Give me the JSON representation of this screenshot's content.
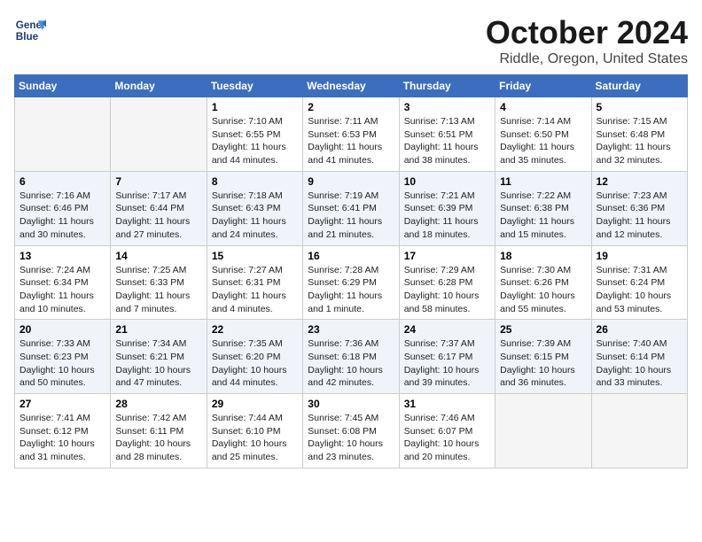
{
  "header": {
    "logo_line1": "General",
    "logo_line2": "Blue",
    "month": "October 2024",
    "location": "Riddle, Oregon, United States"
  },
  "days_of_week": [
    "Sunday",
    "Monday",
    "Tuesday",
    "Wednesday",
    "Thursday",
    "Friday",
    "Saturday"
  ],
  "weeks": [
    [
      {
        "day": "",
        "info": ""
      },
      {
        "day": "",
        "info": ""
      },
      {
        "day": "1",
        "info": "Sunrise: 7:10 AM\nSunset: 6:55 PM\nDaylight: 11 hours and 44 minutes."
      },
      {
        "day": "2",
        "info": "Sunrise: 7:11 AM\nSunset: 6:53 PM\nDaylight: 11 hours and 41 minutes."
      },
      {
        "day": "3",
        "info": "Sunrise: 7:13 AM\nSunset: 6:51 PM\nDaylight: 11 hours and 38 minutes."
      },
      {
        "day": "4",
        "info": "Sunrise: 7:14 AM\nSunset: 6:50 PM\nDaylight: 11 hours and 35 minutes."
      },
      {
        "day": "5",
        "info": "Sunrise: 7:15 AM\nSunset: 6:48 PM\nDaylight: 11 hours and 32 minutes."
      }
    ],
    [
      {
        "day": "6",
        "info": "Sunrise: 7:16 AM\nSunset: 6:46 PM\nDaylight: 11 hours and 30 minutes."
      },
      {
        "day": "7",
        "info": "Sunrise: 7:17 AM\nSunset: 6:44 PM\nDaylight: 11 hours and 27 minutes."
      },
      {
        "day": "8",
        "info": "Sunrise: 7:18 AM\nSunset: 6:43 PM\nDaylight: 11 hours and 24 minutes."
      },
      {
        "day": "9",
        "info": "Sunrise: 7:19 AM\nSunset: 6:41 PM\nDaylight: 11 hours and 21 minutes."
      },
      {
        "day": "10",
        "info": "Sunrise: 7:21 AM\nSunset: 6:39 PM\nDaylight: 11 hours and 18 minutes."
      },
      {
        "day": "11",
        "info": "Sunrise: 7:22 AM\nSunset: 6:38 PM\nDaylight: 11 hours and 15 minutes."
      },
      {
        "day": "12",
        "info": "Sunrise: 7:23 AM\nSunset: 6:36 PM\nDaylight: 11 hours and 12 minutes."
      }
    ],
    [
      {
        "day": "13",
        "info": "Sunrise: 7:24 AM\nSunset: 6:34 PM\nDaylight: 11 hours and 10 minutes."
      },
      {
        "day": "14",
        "info": "Sunrise: 7:25 AM\nSunset: 6:33 PM\nDaylight: 11 hours and 7 minutes."
      },
      {
        "day": "15",
        "info": "Sunrise: 7:27 AM\nSunset: 6:31 PM\nDaylight: 11 hours and 4 minutes."
      },
      {
        "day": "16",
        "info": "Sunrise: 7:28 AM\nSunset: 6:29 PM\nDaylight: 11 hours and 1 minute."
      },
      {
        "day": "17",
        "info": "Sunrise: 7:29 AM\nSunset: 6:28 PM\nDaylight: 10 hours and 58 minutes."
      },
      {
        "day": "18",
        "info": "Sunrise: 7:30 AM\nSunset: 6:26 PM\nDaylight: 10 hours and 55 minutes."
      },
      {
        "day": "19",
        "info": "Sunrise: 7:31 AM\nSunset: 6:24 PM\nDaylight: 10 hours and 53 minutes."
      }
    ],
    [
      {
        "day": "20",
        "info": "Sunrise: 7:33 AM\nSunset: 6:23 PM\nDaylight: 10 hours and 50 minutes."
      },
      {
        "day": "21",
        "info": "Sunrise: 7:34 AM\nSunset: 6:21 PM\nDaylight: 10 hours and 47 minutes."
      },
      {
        "day": "22",
        "info": "Sunrise: 7:35 AM\nSunset: 6:20 PM\nDaylight: 10 hours and 44 minutes."
      },
      {
        "day": "23",
        "info": "Sunrise: 7:36 AM\nSunset: 6:18 PM\nDaylight: 10 hours and 42 minutes."
      },
      {
        "day": "24",
        "info": "Sunrise: 7:37 AM\nSunset: 6:17 PM\nDaylight: 10 hours and 39 minutes."
      },
      {
        "day": "25",
        "info": "Sunrise: 7:39 AM\nSunset: 6:15 PM\nDaylight: 10 hours and 36 minutes."
      },
      {
        "day": "26",
        "info": "Sunrise: 7:40 AM\nSunset: 6:14 PM\nDaylight: 10 hours and 33 minutes."
      }
    ],
    [
      {
        "day": "27",
        "info": "Sunrise: 7:41 AM\nSunset: 6:12 PM\nDaylight: 10 hours and 31 minutes."
      },
      {
        "day": "28",
        "info": "Sunrise: 7:42 AM\nSunset: 6:11 PM\nDaylight: 10 hours and 28 minutes."
      },
      {
        "day": "29",
        "info": "Sunrise: 7:44 AM\nSunset: 6:10 PM\nDaylight: 10 hours and 25 minutes."
      },
      {
        "day": "30",
        "info": "Sunrise: 7:45 AM\nSunset: 6:08 PM\nDaylight: 10 hours and 23 minutes."
      },
      {
        "day": "31",
        "info": "Sunrise: 7:46 AM\nSunset: 6:07 PM\nDaylight: 10 hours and 20 minutes."
      },
      {
        "day": "",
        "info": ""
      },
      {
        "day": "",
        "info": ""
      }
    ]
  ]
}
